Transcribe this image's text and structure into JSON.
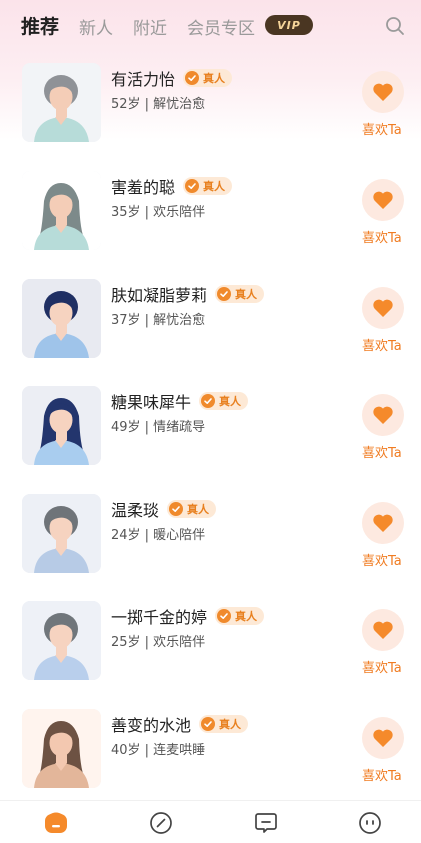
{
  "tabs": [
    {
      "label": "推荐",
      "active": true
    },
    {
      "label": "新人",
      "active": false
    },
    {
      "label": "附近",
      "active": false
    },
    {
      "label": "会员专区",
      "active": false
    }
  ],
  "vip_badge": "VIP",
  "icons": {
    "search": "search-icon",
    "real": "verified-check-icon",
    "like": "heart-icon",
    "nav": [
      "home-icon",
      "compass-icon",
      "message-icon",
      "profile-icon"
    ]
  },
  "colors": {
    "accent": "#f07c22",
    "like_bg": "#fde9e0",
    "badge_bg": "#fde9d6",
    "vip_bg": "#4a3622",
    "vip_text": "#f6d59a"
  },
  "real_label": "真人",
  "like_label": "喜欢Ta",
  "users": [
    {
      "name": "有活力怡",
      "meta": "52岁 | 解忧治愈",
      "avatar_style": "short-hair-teal"
    },
    {
      "name": "害羞的聪",
      "meta": "35岁 | 欢乐陪伴",
      "avatar_style": "long-hair-teal"
    },
    {
      "name": "肤如凝脂萝莉",
      "meta": "37岁 | 解忧治愈",
      "avatar_style": "navy-bun-blue"
    },
    {
      "name": "糖果味犀牛",
      "meta": "49岁 | 情绪疏导",
      "avatar_style": "navy-wavy-blue"
    },
    {
      "name": "温柔琰",
      "meta": "24岁 | 暖心陪伴",
      "avatar_style": "grey-bun-blue"
    },
    {
      "name": "一掷千金的婷",
      "meta": "25岁 | 欢乐陪伴",
      "avatar_style": "grey-bun-lightblue"
    },
    {
      "name": "善变的水池",
      "meta": "40岁 | 连麦哄睡",
      "avatar_style": "brown-long-tan"
    }
  ]
}
